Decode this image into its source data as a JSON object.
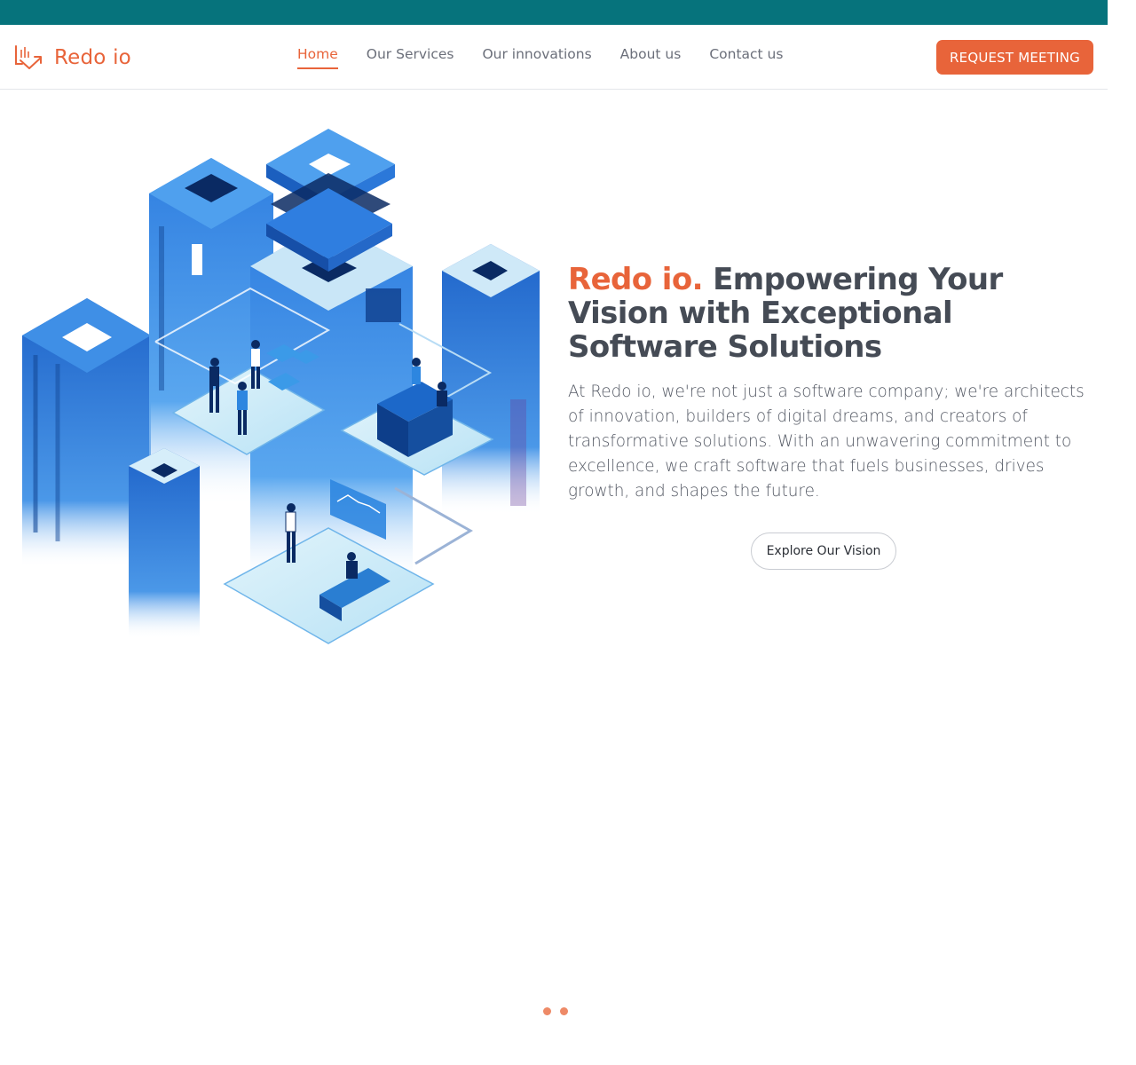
{
  "brand": {
    "name": "Redo io",
    "logo_icon": "chart-arrow-icon",
    "color": "#e8643a"
  },
  "topbar": {
    "color": "#06737c"
  },
  "nav": {
    "items": [
      {
        "label": "Home",
        "active": true
      },
      {
        "label": "Our Services",
        "active": false
      },
      {
        "label": "Our innovations",
        "active": false
      },
      {
        "label": "About us",
        "active": false
      },
      {
        "label": "Contact us",
        "active": false
      }
    ],
    "cta": "REQUEST MEETING"
  },
  "hero": {
    "title_accent": "Redo io.",
    "title_rest": "Empowering Your Vision with Exceptional Software Solutions",
    "description": "At Redo io, we're not just a software company; we're architects of innovation, builders of digital dreams, and creators of transformative solutions. With an unwavering commitment to excellence, we craft software that fuels businesses, drives growth, and shapes the future.",
    "button": "Explore Our Vision",
    "illustration": "isometric-office-buildings-illustration"
  },
  "carousel": {
    "dots": 2
  }
}
